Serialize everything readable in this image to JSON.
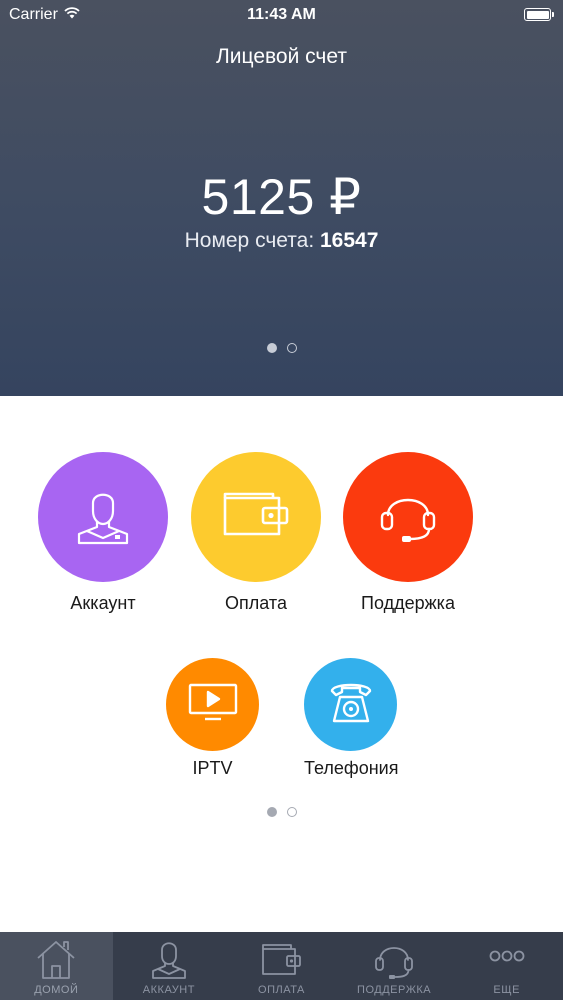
{
  "status_bar": {
    "carrier": "Carrier",
    "time": "11:43 AM"
  },
  "header": {
    "title": "Лицевой счет",
    "balance": "5125 ₽",
    "account_label": "Номер счета:",
    "account_number": "16547"
  },
  "tiles": [
    {
      "label": "Аккаунт",
      "icon": "user-icon",
      "color": "#a865f2"
    },
    {
      "label": "Оплата",
      "icon": "wallet-icon",
      "color": "#fdcb2e"
    },
    {
      "label": "Поддержка",
      "icon": "headset-icon",
      "color": "#fb3a0e"
    },
    {
      "label": "IPTV",
      "icon": "tv-icon",
      "color": "#ff8a00"
    },
    {
      "label": "Телефония",
      "icon": "telephone-icon",
      "color": "#33b0ec"
    }
  ],
  "tab_bar": {
    "items": [
      {
        "label": "ДОМОЙ",
        "icon": "home-icon",
        "active": true
      },
      {
        "label": "АККАУНТ",
        "icon": "user-icon",
        "active": false
      },
      {
        "label": "ОПЛАТА",
        "icon": "wallet-icon",
        "active": false
      },
      {
        "label": "ПОДДЕРЖКА",
        "icon": "headset-icon",
        "active": false
      },
      {
        "label": "ЕЩЕ",
        "icon": "more-icon",
        "active": false
      }
    ]
  },
  "colors": {
    "header_bg": "#3e4b62",
    "tab_bar_bg": "#363d4b",
    "tab_active_bg": "#4a515f"
  }
}
